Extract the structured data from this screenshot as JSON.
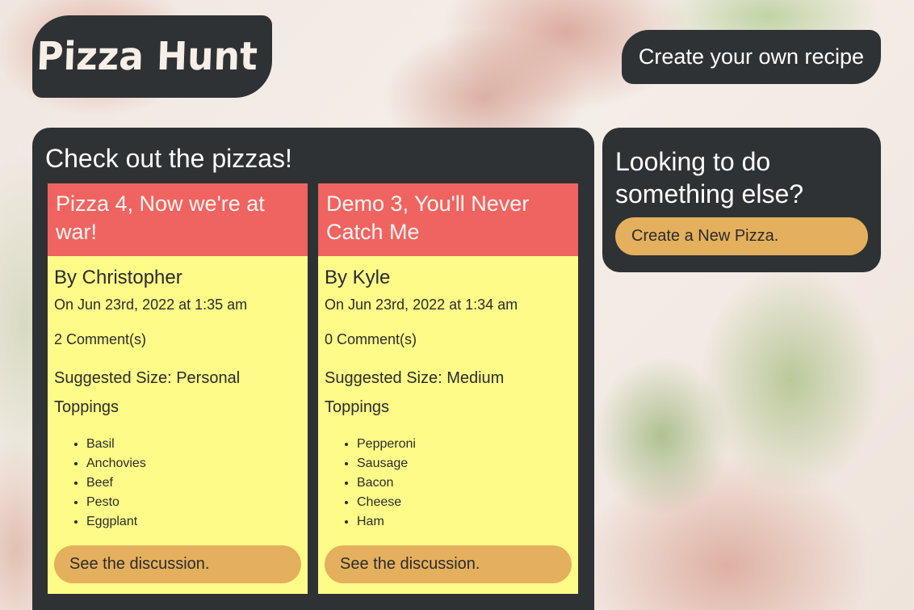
{
  "header": {
    "logo_text": "Pizza Hunt",
    "nav_button_label": "Create your own recipe"
  },
  "main": {
    "heading": "Check out the pizzas!",
    "pizzas": [
      {
        "title": "Pizza 4, Now we're at war!",
        "author": "By Christopher",
        "date": "On Jun 23rd, 2022 at 1:35 am",
        "comments": "2 Comment(s)",
        "size": "Suggested Size: Personal",
        "toppings_heading": "Toppings",
        "toppings": [
          "Basil",
          "Anchovies",
          "Beef",
          "Pesto",
          "Eggplant"
        ],
        "button_label": "See the discussion."
      },
      {
        "title": "Demo 3, You'll Never Catch Me",
        "author": "By Kyle",
        "date": "On Jun 23rd, 2022 at 1:34 am",
        "comments": "0 Comment(s)",
        "size": "Suggested Size: Medium",
        "toppings_heading": "Toppings",
        "toppings": [
          "Pepperoni",
          "Sausage",
          "Bacon",
          "Cheese",
          "Ham"
        ],
        "button_label": "See the discussion."
      }
    ]
  },
  "sidebar": {
    "heading": "Looking to do something else?",
    "button_label": "Create a New Pizza."
  },
  "colors": {
    "panel": "#2f3235",
    "card_header": "#ef6461",
    "card_body": "#fffb88",
    "button": "#e4b05d"
  }
}
